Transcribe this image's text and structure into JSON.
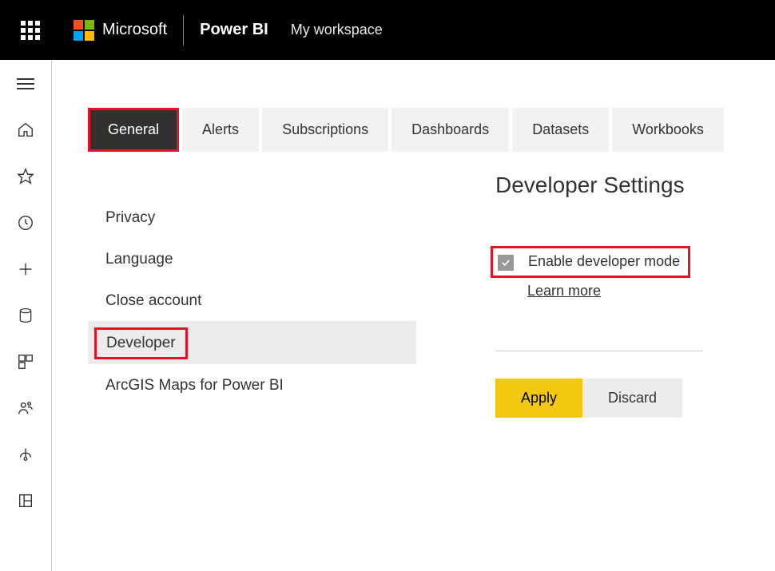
{
  "topbar": {
    "microsoft": "Microsoft",
    "product": "Power BI",
    "workspace": "My workspace"
  },
  "leftrail": {
    "items": [
      "menu",
      "home",
      "favorites",
      "recent",
      "create",
      "data",
      "apps",
      "shared",
      "learn",
      "workspaces"
    ]
  },
  "tabs": [
    {
      "label": "General",
      "active": true
    },
    {
      "label": "Alerts",
      "active": false
    },
    {
      "label": "Subscriptions",
      "active": false
    },
    {
      "label": "Dashboards",
      "active": false
    },
    {
      "label": "Datasets",
      "active": false
    },
    {
      "label": "Workbooks",
      "active": false
    }
  ],
  "settingsNav": [
    {
      "label": "Privacy",
      "selected": false
    },
    {
      "label": "Language",
      "selected": false
    },
    {
      "label": "Close account",
      "selected": false
    },
    {
      "label": "Developer",
      "selected": true
    },
    {
      "label": "ArcGIS Maps for Power BI",
      "selected": false
    }
  ],
  "detail": {
    "title": "Developer Settings",
    "checkboxLabel": "Enable developer mode",
    "checked": true,
    "learnMore": "Learn more",
    "applyLabel": "Apply",
    "discardLabel": "Discard"
  }
}
